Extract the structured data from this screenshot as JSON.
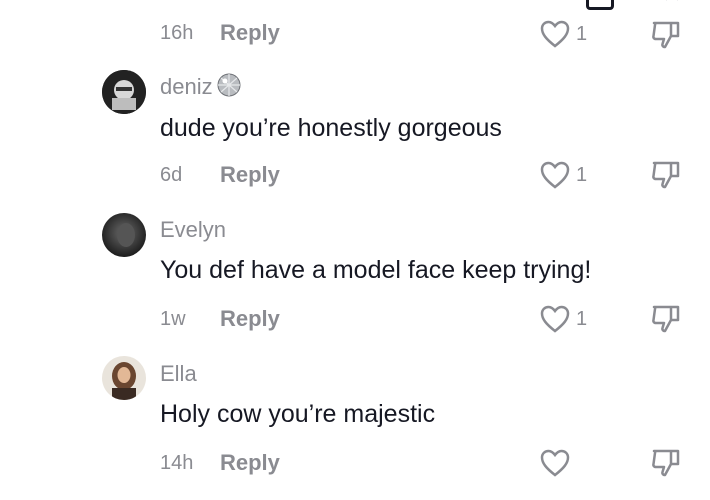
{
  "top_partial": {
    "time": "16h",
    "reply_label": "Reply",
    "like_count": "1"
  },
  "comments": [
    {
      "username": "deniz",
      "text": "dude you’re honestly gorgeous",
      "time": "6d",
      "reply_label": "Reply",
      "like_count": "1"
    },
    {
      "username": "Evelyn",
      "text": "You def have a model face keep trying!",
      "time": "1w",
      "reply_label": "Reply",
      "like_count": "1"
    },
    {
      "username": "Ella",
      "text": "Holy cow you’re majestic",
      "time": "14h",
      "reply_label": "Reply",
      "like_count": ""
    }
  ],
  "colors": {
    "text_primary": "#161823",
    "text_secondary": "#8a8b91",
    "background": "#ffffff"
  },
  "icons": [
    "heart-icon",
    "dislike-icon",
    "disco-ball-icon"
  ]
}
